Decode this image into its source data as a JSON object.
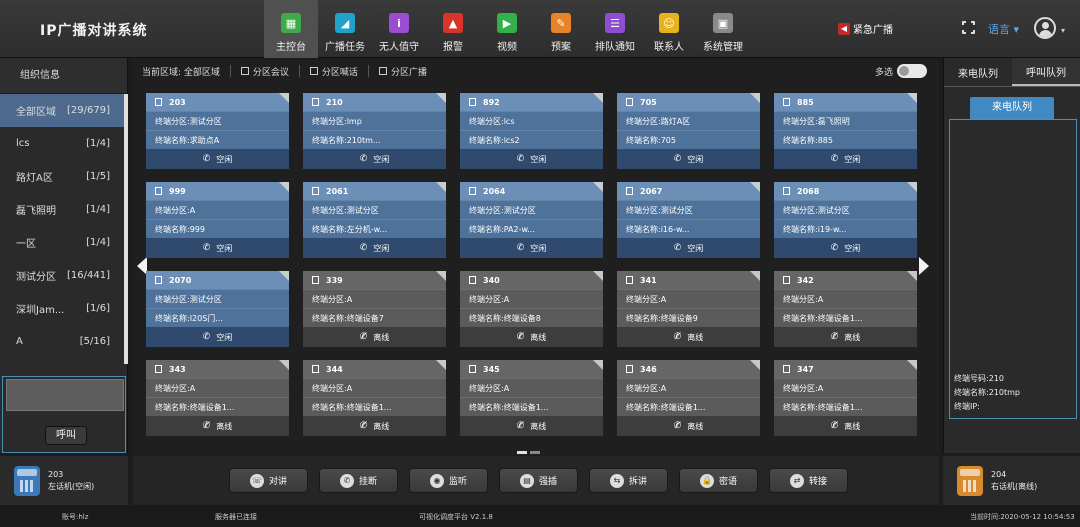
{
  "app": {
    "title": "IP广播对讲系统"
  },
  "nav": [
    {
      "label": "主控台",
      "icon": "console-icon",
      "color": "#3faa4a",
      "glyph": "▦",
      "active": true
    },
    {
      "label": "广播任务",
      "icon": "broadcast-task-icon",
      "color": "#1fa3c9",
      "glyph": "◢"
    },
    {
      "label": "无人值守",
      "icon": "unattended-icon",
      "color": "#9a4dd0",
      "glyph": "i"
    },
    {
      "label": "报警",
      "icon": "alarm-icon",
      "color": "#d9342b",
      "glyph": "▲"
    },
    {
      "label": "视频",
      "icon": "video-icon",
      "color": "#32b04a",
      "glyph": "▶"
    },
    {
      "label": "预案",
      "icon": "plan-icon",
      "color": "#e8832a",
      "glyph": "✎"
    },
    {
      "label": "排队通知",
      "icon": "queue-notice-icon",
      "color": "#8b4fd0",
      "glyph": "☰"
    },
    {
      "label": "联系人",
      "icon": "contacts-icon",
      "color": "#e7b21c",
      "glyph": "☺"
    },
    {
      "label": "系统管理",
      "icon": "system-admin-icon",
      "color": "#8a8a8a",
      "glyph": "▣"
    }
  ],
  "header": {
    "emergency_label": "紧急广播",
    "language_label": "语言"
  },
  "left": {
    "title": "组织信息",
    "groups": [
      {
        "name": "全部区域",
        "count": "[29/679]",
        "active": true
      },
      {
        "name": "lcs",
        "count": "[1/4]"
      },
      {
        "name": "路灯A区",
        "count": "[1/5]"
      },
      {
        "name": "磊飞照明",
        "count": "[1/4]"
      },
      {
        "name": "一区",
        "count": "[1/4]"
      },
      {
        "name": "测试分区",
        "count": "[16/441]"
      },
      {
        "name": "深圳Jam...",
        "count": "[1/6]"
      },
      {
        "name": "A",
        "count": "[5/16]"
      }
    ],
    "call_button": "呼叫",
    "phone": {
      "number": "203",
      "name": "左话机(空闲)"
    }
  },
  "toolbar": {
    "current_area": "当前区域: 全部区域",
    "items": [
      "分区会议",
      "分区喊话",
      "分区广播"
    ],
    "multi_select": "多选"
  },
  "terminals": [
    {
      "id": "203",
      "zone": "终端分区:测试分区",
      "name": "终端名称:求助点A",
      "status": "空闲",
      "online": true
    },
    {
      "id": "210",
      "zone": "终端分区:lmp",
      "name": "终端名称:210tm...",
      "status": "空闲",
      "online": true
    },
    {
      "id": "892",
      "zone": "终端分区:lcs",
      "name": "终端名称:lcs2",
      "status": "空闲",
      "online": true
    },
    {
      "id": "705",
      "zone": "终端分区:路灯A区",
      "name": "终端名称:705",
      "status": "空闲",
      "online": true
    },
    {
      "id": "885",
      "zone": "终端分区:磊飞照明",
      "name": "终端名称:885",
      "status": "空闲",
      "online": true
    },
    {
      "id": "999",
      "zone": "终端分区:A",
      "name": "终端名称:999",
      "status": "空闲",
      "online": true
    },
    {
      "id": "2061",
      "zone": "终端分区:测试分区",
      "name": "终端名称:左分机-w...",
      "status": "空闲",
      "online": true
    },
    {
      "id": "2064",
      "zone": "终端分区:测试分区",
      "name": "终端名称:PA2-w...",
      "status": "空闲",
      "online": true
    },
    {
      "id": "2067",
      "zone": "终端分区:测试分区",
      "name": "终端名称:i16-w...",
      "status": "空闲",
      "online": true
    },
    {
      "id": "2068",
      "zone": "终端分区:测试分区",
      "name": "终端名称:i19-w...",
      "status": "空闲",
      "online": true
    },
    {
      "id": "2070",
      "zone": "终端分区:测试分区",
      "name": "终端名称:I20S门...",
      "status": "空闲",
      "online": true
    },
    {
      "id": "339",
      "zone": "终端分区:A",
      "name": "终端名称:终端设备7",
      "status": "离线",
      "online": false
    },
    {
      "id": "340",
      "zone": "终端分区:A",
      "name": "终端名称:终端设备8",
      "status": "离线",
      "online": false
    },
    {
      "id": "341",
      "zone": "终端分区:A",
      "name": "终端名称:终端设备9",
      "status": "离线",
      "online": false
    },
    {
      "id": "342",
      "zone": "终端分区:A",
      "name": "终端名称:终端设备1...",
      "status": "离线",
      "online": false
    },
    {
      "id": "343",
      "zone": "终端分区:A",
      "name": "终端名称:终端设备1...",
      "status": "离线",
      "online": false
    },
    {
      "id": "344",
      "zone": "终端分区:A",
      "name": "终端名称:终端设备1...",
      "status": "离线",
      "online": false
    },
    {
      "id": "345",
      "zone": "终端分区:A",
      "name": "终端名称:终端设备1...",
      "status": "离线",
      "online": false
    },
    {
      "id": "346",
      "zone": "终端分区:A",
      "name": "终端名称:终端设备1...",
      "status": "离线",
      "online": false
    },
    {
      "id": "347",
      "zone": "终端分区:A",
      "name": "终端名称:终端设备1...",
      "status": "离线",
      "online": false
    }
  ],
  "actions": [
    {
      "label": "对讲",
      "icon": "intercom-icon",
      "glyph": "☏"
    },
    {
      "label": "挂断",
      "icon": "hangup-icon",
      "glyph": "✆"
    },
    {
      "label": "监听",
      "icon": "monitor-icon",
      "glyph": "◉"
    },
    {
      "label": "强插",
      "icon": "force-insert-icon",
      "glyph": "▤"
    },
    {
      "label": "拆讲",
      "icon": "split-talk-icon",
      "glyph": "⇆"
    },
    {
      "label": "密语",
      "icon": "whisper-icon",
      "glyph": "🔒"
    },
    {
      "label": "转接",
      "icon": "transfer-icon",
      "glyph": "⇄"
    }
  ],
  "right": {
    "tabs": [
      "来电队列",
      "呼叫队列"
    ],
    "active_tab": 1,
    "queue_button": "来电队列",
    "info": [
      "终端号码:210",
      "终端名称:210tmp",
      "终端IP:"
    ],
    "phone": {
      "number": "204",
      "name": "右话机(离线)"
    }
  },
  "status": {
    "account": "账号:hlz",
    "server": "服务器已连接",
    "platform": "可视化调度平台  V2.1.8",
    "time": "当前时间:2020-05-12 10:54:53"
  }
}
